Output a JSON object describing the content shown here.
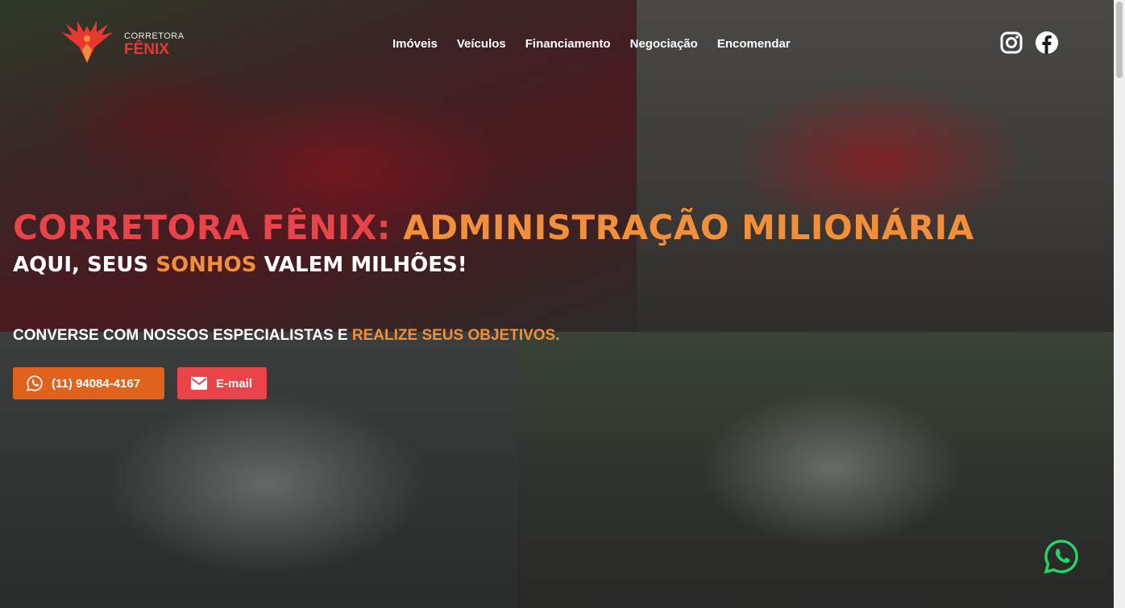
{
  "brand": {
    "logo_small": "CORRETORA",
    "logo_big": "FÊNIX"
  },
  "nav": {
    "items": [
      {
        "label": "Imóveis"
      },
      {
        "label": "Veículos"
      },
      {
        "label": "Financiamento"
      },
      {
        "label": "Negociação"
      },
      {
        "label": "Encomendar"
      }
    ]
  },
  "social": {
    "icons": [
      "instagram-icon",
      "facebook-icon"
    ]
  },
  "hero": {
    "headline_part1": "CORRETORA FÊNIX:",
    "headline_part2": "ADMINISTRAÇÃO MILIONÁRIA",
    "sub_part1": "AQUI, SEUS",
    "sub_highlight": "SONHOS",
    "sub_part2": "VALEM MILHÕES!",
    "cta_part1": "CONVERSE COM NOSSOS ESPECIALISTAS E",
    "cta_highlight": "REALIZE SEUS OBJETIVOS.",
    "phone_label": "(11) 94084-4167",
    "email_label": "E-mail"
  },
  "colors": {
    "red": "#e8444a",
    "orange": "#f28f3b",
    "phone_button": "#e1621c",
    "email_button": "#e9444a",
    "whatsapp": "#25d366"
  }
}
